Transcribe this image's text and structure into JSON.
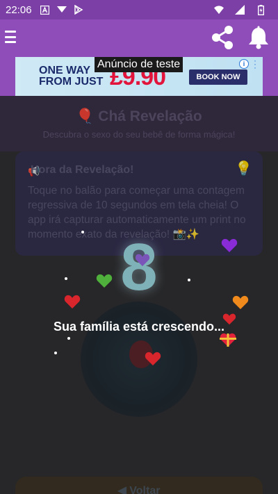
{
  "status_bar": {
    "time": "22:06",
    "icons": [
      "a-icon",
      "download-icon",
      "play-store-icon",
      "wifi-icon",
      "signal-icon",
      "battery-icon"
    ]
  },
  "app_bar": {
    "icons": [
      "menu-icon",
      "share-icon",
      "bell-icon"
    ]
  },
  "ad": {
    "label": "Anúncio de teste",
    "headline_line1": "ONE WAY",
    "headline_line2": "FROM JUST",
    "price": "£9.90",
    "cta": "BOOK NOW"
  },
  "page": {
    "title": "Chá Revelação",
    "subtitle": "Descubra o sexo do seu bebê de forma mágica!",
    "card_title": "Hora da Revelação!",
    "card_text": "Toque no balão para começar uma contagem regressiva de 10 segundos em tela cheia! O app irá capturar automaticamente um print no momento exato da revelação! 📸✨",
    "back_button": "Voltar"
  },
  "countdown": {
    "number": "8",
    "message": "Sua família está crescendo..."
  },
  "colors": {
    "status_bar": "#7b3fa6",
    "app_bar": "#8e4db8",
    "countdown_number": "#7fb2b8"
  }
}
